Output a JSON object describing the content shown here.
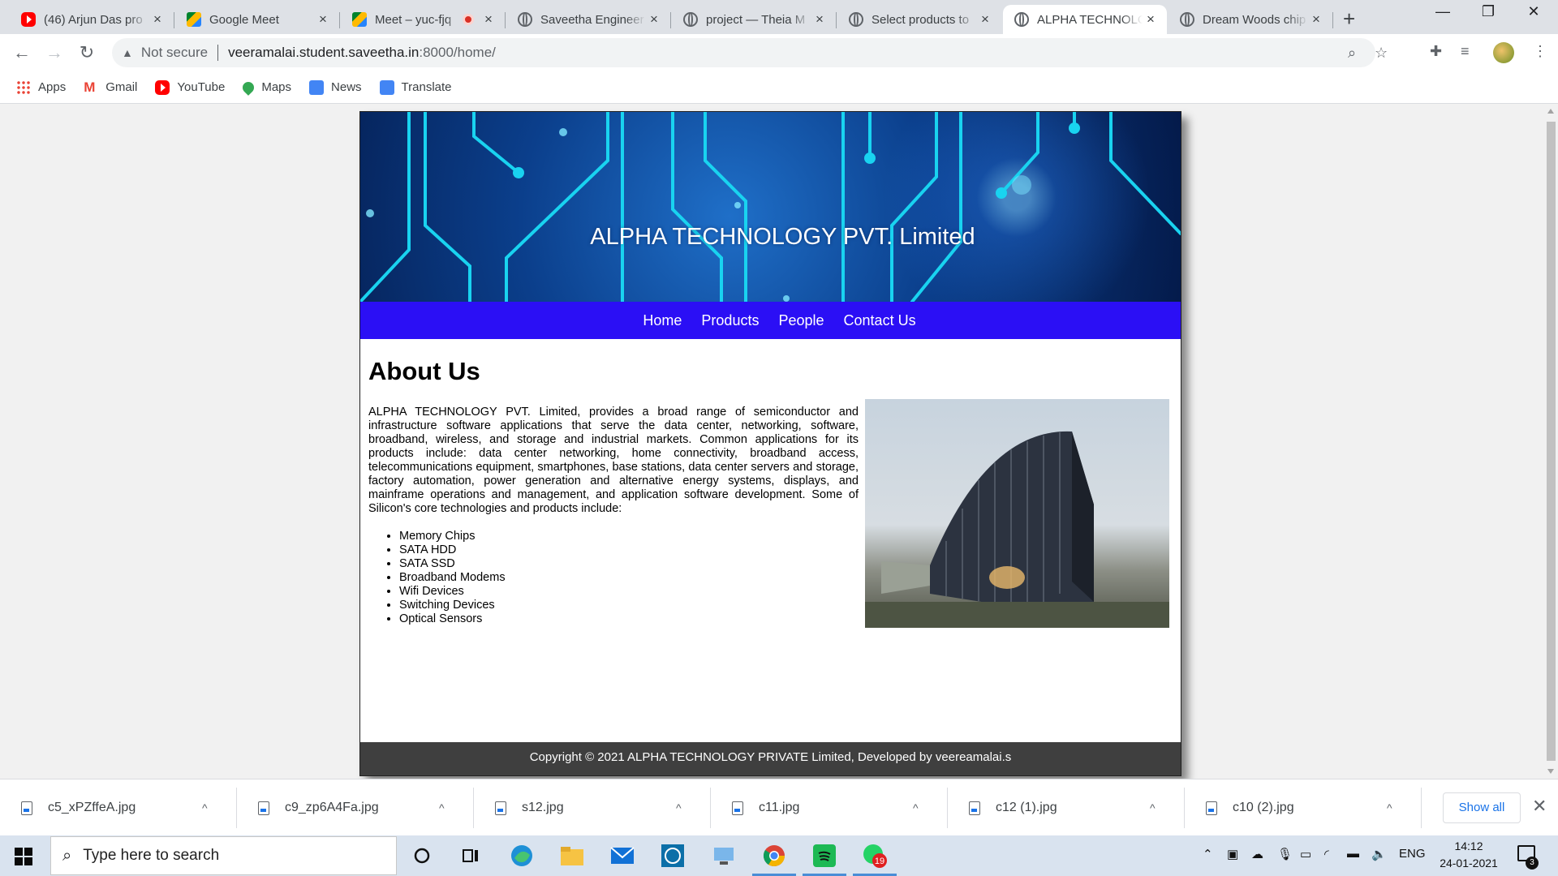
{
  "browser": {
    "tabs": [
      {
        "title": "(46) Arjun Das pro",
        "icon": "youtube-icon",
        "active": false
      },
      {
        "title": "Google Meet",
        "icon": "meet-icon",
        "active": false
      },
      {
        "title": "Meet – yuc-fjq",
        "icon": "meet-icon",
        "active": false,
        "recording": true
      },
      {
        "title": "Saveetha Engineer",
        "icon": "globe-icon",
        "active": false
      },
      {
        "title": "project — Theia M",
        "icon": "globe-icon",
        "active": false
      },
      {
        "title": "Select products to",
        "icon": "globe-icon",
        "active": false
      },
      {
        "title": "ALPHA TECHNOLOG",
        "icon": "globe-icon",
        "active": true
      },
      {
        "title": "Dream Woods chip",
        "icon": "globe-icon",
        "active": false
      }
    ],
    "new_tab_glyph": "+",
    "close_glyph": "×",
    "window_controls": {
      "minimize": "—",
      "maximize": "❐",
      "close": "✕"
    },
    "nav": {
      "back": "←",
      "forward": "→",
      "reload": "↻"
    },
    "address": {
      "security_label": "Not secure",
      "host": "veeramalai.student.saveetha.in",
      "path": ":8000/home/"
    },
    "bookmarks": [
      {
        "label": "Apps",
        "icon": "apps-grid-icon"
      },
      {
        "label": "Gmail",
        "icon": "gmail-icon"
      },
      {
        "label": "YouTube",
        "icon": "youtube-icon"
      },
      {
        "label": "Maps",
        "icon": "maps-pin-icon"
      },
      {
        "label": "News",
        "icon": "news-icon"
      },
      {
        "label": "Translate",
        "icon": "translate-icon"
      }
    ]
  },
  "site": {
    "banner_title": "ALPHA TECHNOLOGY PVT. Limited",
    "nav": [
      {
        "label": "Home"
      },
      {
        "label": "Products"
      },
      {
        "label": "People"
      },
      {
        "label": "Contact Us"
      }
    ],
    "about_heading": "About Us",
    "about_text": "ALPHA TECHNOLOGY PVT. Limited, provides a broad range of semiconductor and infrastructure software applications that serve the data center, networking, software, broadband, wireless, and storage and industrial markets. Common applications for its products include: data center networking, home connectivity, broadband access, telecommunications equipment, smartphones, base stations, data center servers and storage, factory automation, power generation and alternative energy systems, displays, and mainframe operations and management, and application software development. Some of Silicon's core technologies and products include:",
    "features": [
      "Memory Chips",
      "SATA HDD",
      "SATA SSD",
      "Broadband Modems",
      "Wifi Devices",
      "Switching Devices",
      "Optical Sensors"
    ],
    "footer": "Copyright © 2021 ALPHA TECHNOLOGY PRIVATE Limited, Developed by veereamalai.s",
    "colors": {
      "nav_bg": "#2b0ff5",
      "footer_bg": "#3f3f3f",
      "banner_circuit": "#19d3f0"
    }
  },
  "downloads": {
    "files": [
      "c5_xPZffeA.jpg",
      "c9_zp6A4Fa.jpg",
      "s12.jpg",
      "c11.jpg",
      "c12 (1).jpg",
      "c10 (2).jpg"
    ],
    "show_all_label": "Show all",
    "caret_glyph": "^",
    "close_glyph": "✕"
  },
  "taskbar": {
    "search_placeholder": "Type here to search",
    "language": "ENG",
    "time": "14:12",
    "date": "24-01-2021",
    "notification_count": "3",
    "whatsapp_badge": "19"
  }
}
